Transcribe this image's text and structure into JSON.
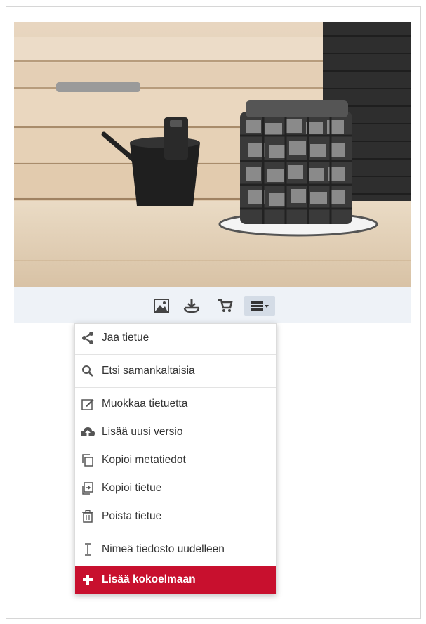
{
  "toolbar": {
    "buttons": [
      {
        "icon": "image-icon",
        "label": ""
      },
      {
        "icon": "download-icon",
        "label": ""
      },
      {
        "icon": "cart-icon",
        "label": ""
      },
      {
        "icon": "menu-dropdown-icon",
        "label": ""
      }
    ]
  },
  "menu": {
    "share": "Jaa tietue",
    "find_similar": "Etsi samankaltaisia",
    "edit": "Muokkaa tietuetta",
    "new_version": "Lisää uusi versio",
    "copy_metadata": "Kopioi metatiedot",
    "copy_record": "Kopioi tietue",
    "delete": "Poista tietue",
    "rename": "Nimeä tiedosto uudelleen",
    "add_to_collection": "Lisää kokoelmaan"
  },
  "colors": {
    "accent": "#c8102e",
    "toolbar_bg": "#eef2f7"
  }
}
